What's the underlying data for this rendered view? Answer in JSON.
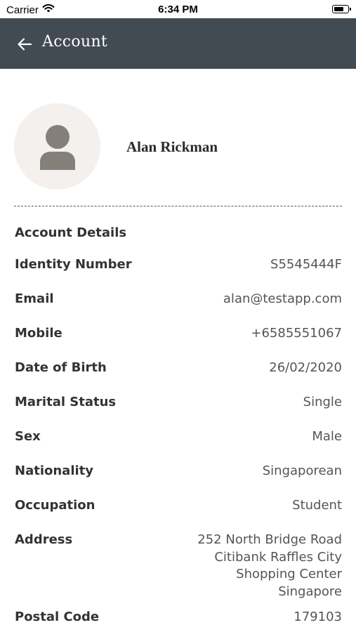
{
  "status_bar": {
    "carrier": "Carrier",
    "time": "6:34 PM"
  },
  "nav": {
    "back_icon": "arrow-left-icon",
    "title": "Account"
  },
  "profile": {
    "avatar_icon": "user-silhouette-icon",
    "name": "Alan Rickman"
  },
  "section": {
    "title": "Account Details"
  },
  "details": {
    "identity_number": {
      "label": "Identity Number",
      "value": "S5545444F"
    },
    "email": {
      "label": "Email",
      "value": "alan@testapp.com"
    },
    "mobile": {
      "label": "Mobile",
      "value": "+6585551067"
    },
    "date_of_birth": {
      "label": "Date of Birth",
      "value": "26/02/2020"
    },
    "marital_status": {
      "label": "Marital Status",
      "value": "Single"
    },
    "sex": {
      "label": "Sex",
      "value": "Male"
    },
    "nationality": {
      "label": "Nationality",
      "value": "Singaporean"
    },
    "occupation": {
      "label": "Occupation",
      "value": "Student"
    },
    "address": {
      "label": "Address",
      "lines": [
        "252 North Bridge Road",
        "Citibank Raffles City",
        "Shopping Center",
        "Singapore"
      ]
    },
    "postal_code": {
      "label": "Postal Code",
      "value": "179103"
    }
  },
  "colors": {
    "nav_background": "#424a52",
    "avatar_background": "#f3f0ee",
    "avatar_icon": "#857f79"
  }
}
